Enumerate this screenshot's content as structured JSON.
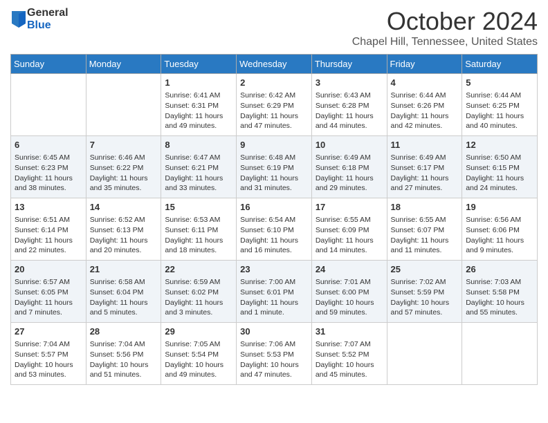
{
  "header": {
    "logo_general": "General",
    "logo_blue": "Blue",
    "month": "October 2024",
    "location": "Chapel Hill, Tennessee, United States"
  },
  "days_of_week": [
    "Sunday",
    "Monday",
    "Tuesday",
    "Wednesday",
    "Thursday",
    "Friday",
    "Saturday"
  ],
  "weeks": [
    [
      {
        "day": "",
        "info": ""
      },
      {
        "day": "",
        "info": ""
      },
      {
        "day": "1",
        "info": "Sunrise: 6:41 AM\nSunset: 6:31 PM\nDaylight: 11 hours and 49 minutes."
      },
      {
        "day": "2",
        "info": "Sunrise: 6:42 AM\nSunset: 6:29 PM\nDaylight: 11 hours and 47 minutes."
      },
      {
        "day": "3",
        "info": "Sunrise: 6:43 AM\nSunset: 6:28 PM\nDaylight: 11 hours and 44 minutes."
      },
      {
        "day": "4",
        "info": "Sunrise: 6:44 AM\nSunset: 6:26 PM\nDaylight: 11 hours and 42 minutes."
      },
      {
        "day": "5",
        "info": "Sunrise: 6:44 AM\nSunset: 6:25 PM\nDaylight: 11 hours and 40 minutes."
      }
    ],
    [
      {
        "day": "6",
        "info": "Sunrise: 6:45 AM\nSunset: 6:23 PM\nDaylight: 11 hours and 38 minutes."
      },
      {
        "day": "7",
        "info": "Sunrise: 6:46 AM\nSunset: 6:22 PM\nDaylight: 11 hours and 35 minutes."
      },
      {
        "day": "8",
        "info": "Sunrise: 6:47 AM\nSunset: 6:21 PM\nDaylight: 11 hours and 33 minutes."
      },
      {
        "day": "9",
        "info": "Sunrise: 6:48 AM\nSunset: 6:19 PM\nDaylight: 11 hours and 31 minutes."
      },
      {
        "day": "10",
        "info": "Sunrise: 6:49 AM\nSunset: 6:18 PM\nDaylight: 11 hours and 29 minutes."
      },
      {
        "day": "11",
        "info": "Sunrise: 6:49 AM\nSunset: 6:17 PM\nDaylight: 11 hours and 27 minutes."
      },
      {
        "day": "12",
        "info": "Sunrise: 6:50 AM\nSunset: 6:15 PM\nDaylight: 11 hours and 24 minutes."
      }
    ],
    [
      {
        "day": "13",
        "info": "Sunrise: 6:51 AM\nSunset: 6:14 PM\nDaylight: 11 hours and 22 minutes."
      },
      {
        "day": "14",
        "info": "Sunrise: 6:52 AM\nSunset: 6:13 PM\nDaylight: 11 hours and 20 minutes."
      },
      {
        "day": "15",
        "info": "Sunrise: 6:53 AM\nSunset: 6:11 PM\nDaylight: 11 hours and 18 minutes."
      },
      {
        "day": "16",
        "info": "Sunrise: 6:54 AM\nSunset: 6:10 PM\nDaylight: 11 hours and 16 minutes."
      },
      {
        "day": "17",
        "info": "Sunrise: 6:55 AM\nSunset: 6:09 PM\nDaylight: 11 hours and 14 minutes."
      },
      {
        "day": "18",
        "info": "Sunrise: 6:55 AM\nSunset: 6:07 PM\nDaylight: 11 hours and 11 minutes."
      },
      {
        "day": "19",
        "info": "Sunrise: 6:56 AM\nSunset: 6:06 PM\nDaylight: 11 hours and 9 minutes."
      }
    ],
    [
      {
        "day": "20",
        "info": "Sunrise: 6:57 AM\nSunset: 6:05 PM\nDaylight: 11 hours and 7 minutes."
      },
      {
        "day": "21",
        "info": "Sunrise: 6:58 AM\nSunset: 6:04 PM\nDaylight: 11 hours and 5 minutes."
      },
      {
        "day": "22",
        "info": "Sunrise: 6:59 AM\nSunset: 6:02 PM\nDaylight: 11 hours and 3 minutes."
      },
      {
        "day": "23",
        "info": "Sunrise: 7:00 AM\nSunset: 6:01 PM\nDaylight: 11 hours and 1 minute."
      },
      {
        "day": "24",
        "info": "Sunrise: 7:01 AM\nSunset: 6:00 PM\nDaylight: 10 hours and 59 minutes."
      },
      {
        "day": "25",
        "info": "Sunrise: 7:02 AM\nSunset: 5:59 PM\nDaylight: 10 hours and 57 minutes."
      },
      {
        "day": "26",
        "info": "Sunrise: 7:03 AM\nSunset: 5:58 PM\nDaylight: 10 hours and 55 minutes."
      }
    ],
    [
      {
        "day": "27",
        "info": "Sunrise: 7:04 AM\nSunset: 5:57 PM\nDaylight: 10 hours and 53 minutes."
      },
      {
        "day": "28",
        "info": "Sunrise: 7:04 AM\nSunset: 5:56 PM\nDaylight: 10 hours and 51 minutes."
      },
      {
        "day": "29",
        "info": "Sunrise: 7:05 AM\nSunset: 5:54 PM\nDaylight: 10 hours and 49 minutes."
      },
      {
        "day": "30",
        "info": "Sunrise: 7:06 AM\nSunset: 5:53 PM\nDaylight: 10 hours and 47 minutes."
      },
      {
        "day": "31",
        "info": "Sunrise: 7:07 AM\nSunset: 5:52 PM\nDaylight: 10 hours and 45 minutes."
      },
      {
        "day": "",
        "info": ""
      },
      {
        "day": "",
        "info": ""
      }
    ]
  ]
}
